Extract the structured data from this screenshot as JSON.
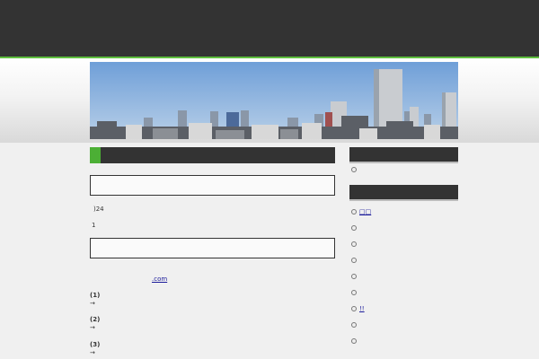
{
  "main": {
    "line1": ")24",
    "line2": "1",
    "link_text": ".com",
    "items": [
      {
        "title": "(1)",
        "arrow": "→"
      },
      {
        "title": "(2)",
        "arrow": "→"
      },
      {
        "title": "(3)",
        "arrow": "→"
      }
    ]
  },
  "sidebar": {
    "links": [
      "□□",
      "",
      "",
      "",
      "",
      "",
      "!!",
      "",
      ""
    ]
  },
  "colors": {
    "dark": "#333333",
    "accent": "#4caf35"
  }
}
